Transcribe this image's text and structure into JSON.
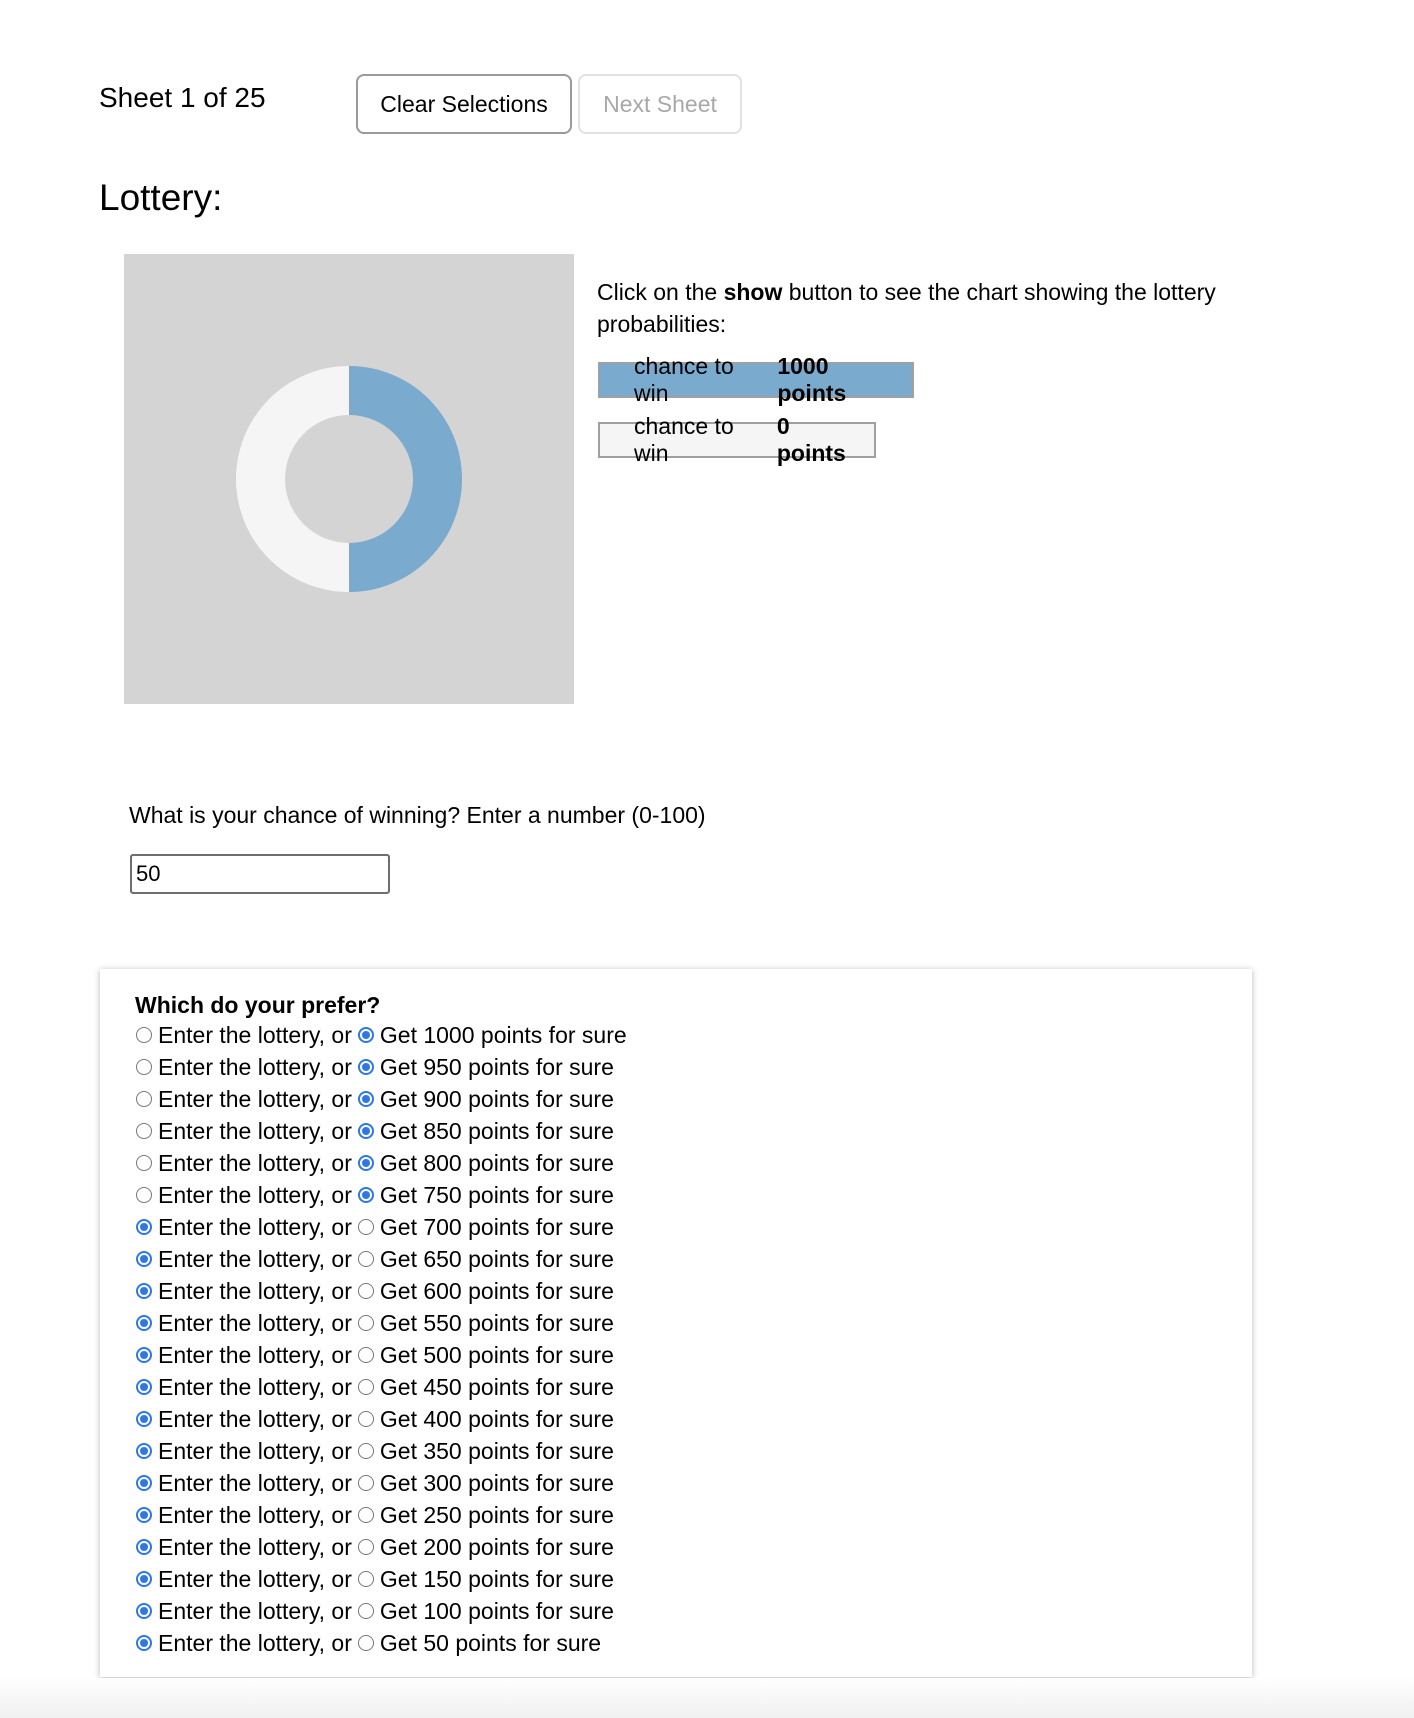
{
  "header": {
    "sheet_label": "Sheet 1 of 25",
    "clear_button": "Clear Selections",
    "next_button": "Next Sheet"
  },
  "lottery": {
    "heading": "Lottery:",
    "instructions_pre": "Click on the ",
    "instructions_bold": "show",
    "instructions_post": " button to see the chart showing the lottery probabilities:",
    "legend": [
      {
        "prefix": "chance to win",
        "amount": "1000 points",
        "color": "#7aaacd"
      },
      {
        "prefix": "chance to win",
        "amount": "0 points",
        "color": "#f5f5f5"
      }
    ]
  },
  "chart_data": {
    "type": "pie",
    "title": "",
    "slices": [
      {
        "label": "chance to win 1000 points",
        "value": 50,
        "color": "#7aaacd"
      },
      {
        "label": "chance to win 0 points",
        "value": 50,
        "color": "#f5f5f5"
      }
    ],
    "background": "#d4d4d4",
    "donut": true
  },
  "chance": {
    "question": "What is your chance of winning? Enter a number (0-100)",
    "value": "50"
  },
  "preferences": {
    "title": "Which do your prefer?",
    "rows": [
      {
        "lottery_label": "Enter the lottery, or",
        "sure_label": "Get 1000 points for sure",
        "selected": "sure"
      },
      {
        "lottery_label": "Enter the lottery, or",
        "sure_label": "Get 950 points for sure",
        "selected": "sure"
      },
      {
        "lottery_label": "Enter the lottery, or",
        "sure_label": "Get 900 points for sure",
        "selected": "sure"
      },
      {
        "lottery_label": "Enter the lottery, or",
        "sure_label": "Get 850 points for sure",
        "selected": "sure"
      },
      {
        "lottery_label": "Enter the lottery, or",
        "sure_label": "Get 800 points for sure",
        "selected": "sure"
      },
      {
        "lottery_label": "Enter the lottery, or",
        "sure_label": "Get 750 points for sure",
        "selected": "sure"
      },
      {
        "lottery_label": "Enter the lottery, or",
        "sure_label": "Get 700 points for sure",
        "selected": "lottery"
      },
      {
        "lottery_label": "Enter the lottery, or",
        "sure_label": "Get 650 points for sure",
        "selected": "lottery"
      },
      {
        "lottery_label": "Enter the lottery, or",
        "sure_label": "Get 600 points for sure",
        "selected": "lottery"
      },
      {
        "lottery_label": "Enter the lottery, or",
        "sure_label": "Get 550 points for sure",
        "selected": "lottery"
      },
      {
        "lottery_label": "Enter the lottery, or",
        "sure_label": "Get 500 points for sure",
        "selected": "lottery"
      },
      {
        "lottery_label": "Enter the lottery, or",
        "sure_label": "Get 450 points for sure",
        "selected": "lottery"
      },
      {
        "lottery_label": "Enter the lottery, or",
        "sure_label": "Get 400 points for sure",
        "selected": "lottery"
      },
      {
        "lottery_label": "Enter the lottery, or",
        "sure_label": "Get 350 points for sure",
        "selected": "lottery"
      },
      {
        "lottery_label": "Enter the lottery, or",
        "sure_label": "Get 300 points for sure",
        "selected": "lottery"
      },
      {
        "lottery_label": "Enter the lottery, or",
        "sure_label": "Get 250 points for sure",
        "selected": "lottery"
      },
      {
        "lottery_label": "Enter the lottery, or",
        "sure_label": "Get 200 points for sure",
        "selected": "lottery"
      },
      {
        "lottery_label": "Enter the lottery, or",
        "sure_label": "Get 150 points for sure",
        "selected": "lottery"
      },
      {
        "lottery_label": "Enter the lottery, or",
        "sure_label": "Get 100 points for sure",
        "selected": "lottery"
      },
      {
        "lottery_label": "Enter the lottery, or",
        "sure_label": "Get 50 points for sure",
        "selected": "lottery"
      }
    ]
  }
}
